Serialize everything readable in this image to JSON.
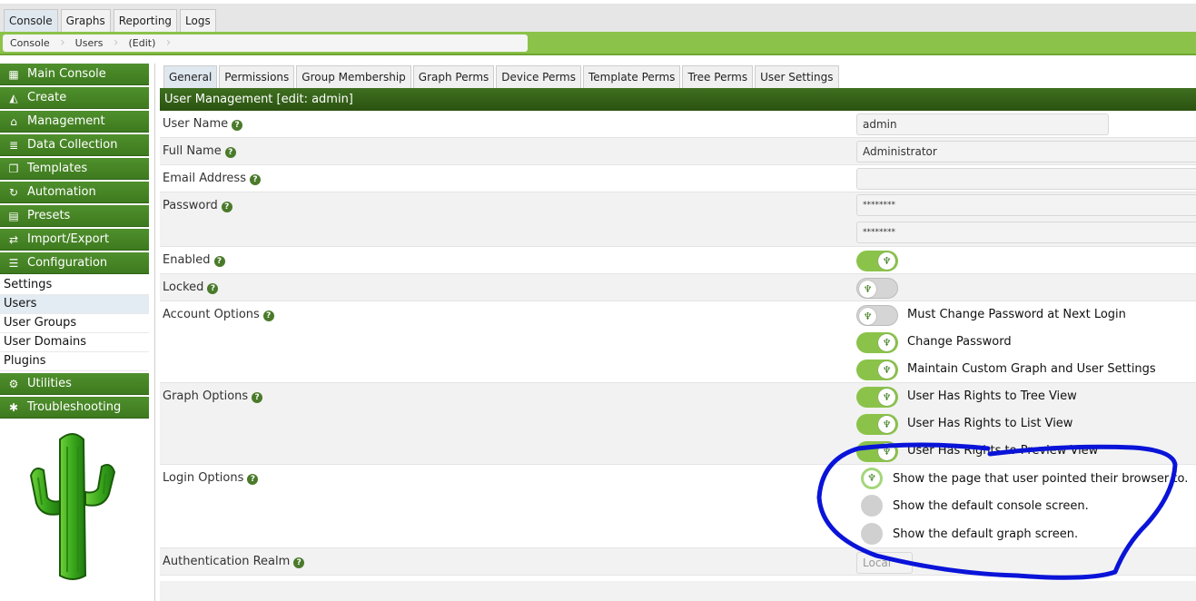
{
  "top_tabs": [
    {
      "label": "Console",
      "active": true
    },
    {
      "label": "Graphs",
      "active": false
    },
    {
      "label": "Reporting",
      "active": false
    },
    {
      "label": "Logs",
      "active": false
    }
  ],
  "breadcrumb": [
    "Console",
    "Users",
    "(Edit)"
  ],
  "sidebar": {
    "menu": [
      {
        "label": "Main Console",
        "icon": "map-icon"
      },
      {
        "label": "Create",
        "icon": "area-chart-icon"
      },
      {
        "label": "Management",
        "icon": "home-icon"
      },
      {
        "label": "Data Collection",
        "icon": "database-icon"
      },
      {
        "label": "Templates",
        "icon": "copy-icon"
      },
      {
        "label": "Automation",
        "icon": "refresh-icon"
      },
      {
        "label": "Presets",
        "icon": "archive-icon"
      },
      {
        "label": "Import/Export",
        "icon": "exchange-icon"
      },
      {
        "label": "Configuration",
        "icon": "sliders-icon"
      }
    ],
    "sub_items": [
      {
        "label": "Settings",
        "active": false
      },
      {
        "label": "Users",
        "active": true
      },
      {
        "label": "User Groups",
        "active": false
      },
      {
        "label": "User Domains",
        "active": false
      },
      {
        "label": "Plugins",
        "active": false
      }
    ],
    "menu_bottom": [
      {
        "label": "Utilities",
        "icon": "cogs-icon"
      },
      {
        "label": "Troubleshooting",
        "icon": "bug-icon"
      }
    ]
  },
  "content_tabs": [
    {
      "label": "General",
      "active": true
    },
    {
      "label": "Permissions",
      "active": false
    },
    {
      "label": "Group Membership",
      "active": false
    },
    {
      "label": "Graph Perms",
      "active": false
    },
    {
      "label": "Device Perms",
      "active": false
    },
    {
      "label": "Template Perms",
      "active": false
    },
    {
      "label": "Tree Perms",
      "active": false
    },
    {
      "label": "User Settings",
      "active": false
    }
  ],
  "panel": {
    "header": "User Management [edit: admin]",
    "username_label": "User Name",
    "username_value": "admin",
    "fullname_label": "Full Name",
    "fullname_value": "Administrator",
    "email_label": "Email Address",
    "email_value": "",
    "password_label": "Password",
    "password_value": "********",
    "password_confirm_value": "********",
    "enabled_label": "Enabled",
    "enabled": true,
    "locked_label": "Locked",
    "locked": false,
    "account_options_label": "Account Options",
    "account_options": [
      {
        "label": "Must Change Password at Next Login",
        "on": false
      },
      {
        "label": "Change Password",
        "on": true
      },
      {
        "label": "Maintain Custom Graph and User Settings",
        "on": true
      }
    ],
    "graph_options_label": "Graph Options",
    "graph_options": [
      {
        "label": "User Has Rights to Tree View",
        "on": true
      },
      {
        "label": "User Has Rights to List View",
        "on": true
      },
      {
        "label": "User Has Rights to Preview View",
        "on": true
      }
    ],
    "login_options_label": "Login Options",
    "login_options": [
      {
        "label": "Show the page that user pointed their browser to.",
        "selected": true
      },
      {
        "label": "Show the default console screen.",
        "selected": false
      },
      {
        "label": "Show the default graph screen.",
        "selected": false
      }
    ],
    "auth_realm_label": "Authentication Realm",
    "auth_realm_value": "Local"
  },
  "colors": {
    "brand_green": "#8bc34a",
    "menu_green": "#3e7a1f",
    "header_green": "#2a5210",
    "annotation_blue": "#0a14d8"
  }
}
